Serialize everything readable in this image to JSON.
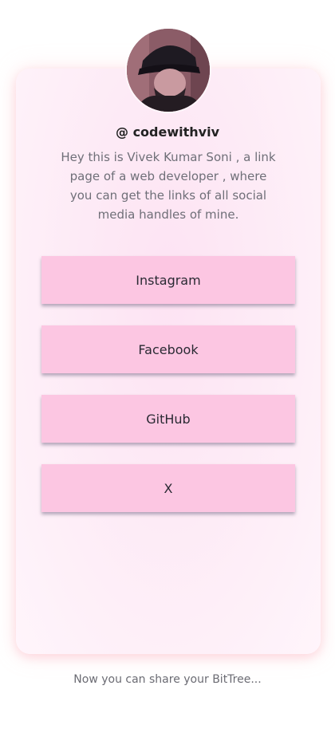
{
  "profile": {
    "handle": "@ codewithviv",
    "bio": "Hey this is Vivek Kumar Soni , a link page of a web developer , where you can get the links of all social media handles of mine."
  },
  "links": [
    {
      "label": "Instagram"
    },
    {
      "label": "Facebook"
    },
    {
      "label": "GitHub"
    },
    {
      "label": "X"
    }
  ],
  "footer": {
    "text": "Now you can share your BitTree..."
  },
  "colors": {
    "button": "#fcc6e2",
    "card": "#fdebf6",
    "card_glow": "#ffbecb"
  }
}
